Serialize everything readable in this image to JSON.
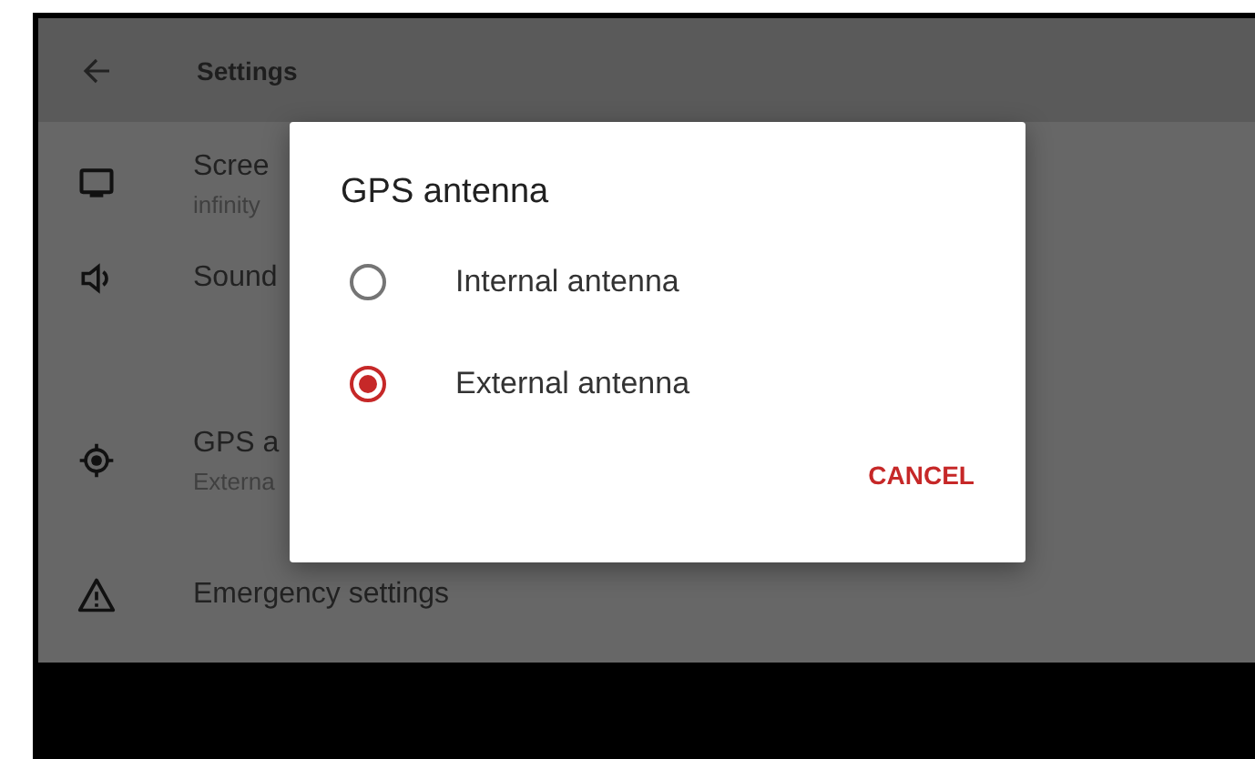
{
  "app_bar": {
    "title": "Settings"
  },
  "settings": [
    {
      "kind": "monitor",
      "title": "Scree",
      "subtitle": "infinity"
    },
    {
      "kind": "speaker",
      "title": "Sound"
    },
    {
      "kind": "target",
      "title": "GPS a",
      "subtitle": "Externa"
    },
    {
      "kind": "warning",
      "title": "Emergency settings"
    }
  ],
  "dialog": {
    "title": "GPS antenna",
    "options": [
      {
        "label": "Internal antenna",
        "selected": false
      },
      {
        "label": "External antenna",
        "selected": true
      }
    ],
    "buttons": [
      "CANCEL"
    ]
  }
}
